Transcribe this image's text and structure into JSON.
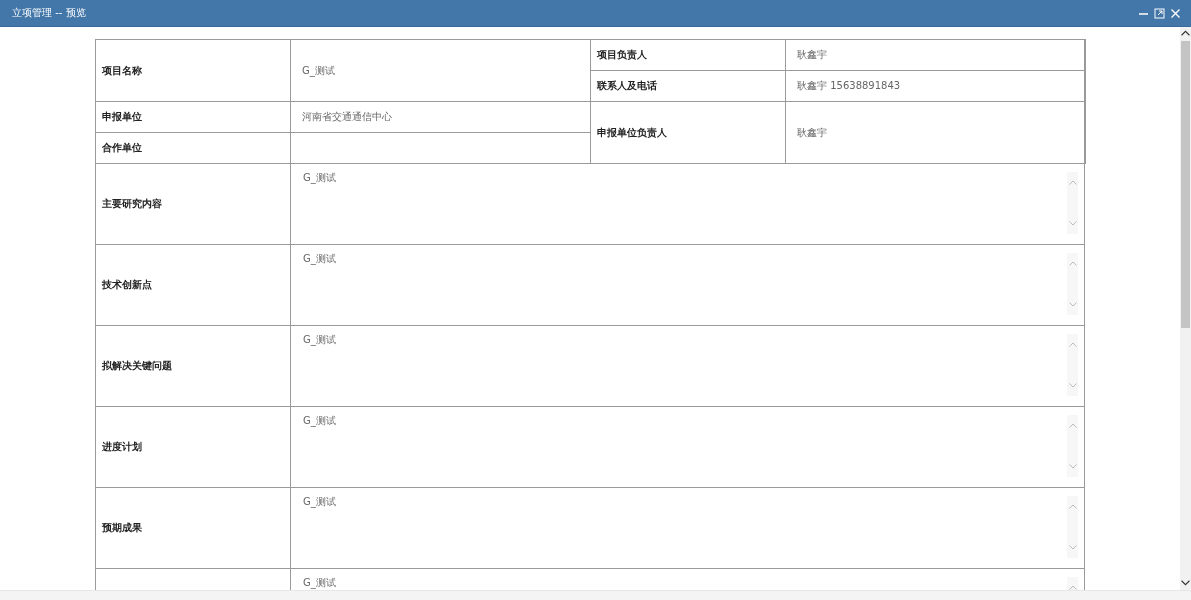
{
  "window": {
    "title": "立项管理 -- 预览"
  },
  "header_rows": [
    {
      "label": "项目名称",
      "value": "G_测试"
    },
    {
      "label": "项目负责人",
      "value": "耿鑫宇"
    },
    {
      "label": "联系人及电话",
      "value": "耿鑫宇 15638891843"
    },
    {
      "label": "申报单位",
      "value": "河南省交通通信中心"
    },
    {
      "label": "合作单位"
    },
    {
      "label": "申报单位负责人",
      "value": "耿鑫宇"
    }
  ],
  "sections": [
    {
      "label": "主要研究内容",
      "value": "G_测试"
    },
    {
      "label": "技术创新点",
      "value": "G_测试"
    },
    {
      "label": "拟解决关键问题",
      "value": "G_测试"
    },
    {
      "label": "进度计划",
      "value": "G_测试"
    },
    {
      "label": "预期成果",
      "value": "G_测试"
    },
    {
      "value": "G_测试"
    }
  ]
}
